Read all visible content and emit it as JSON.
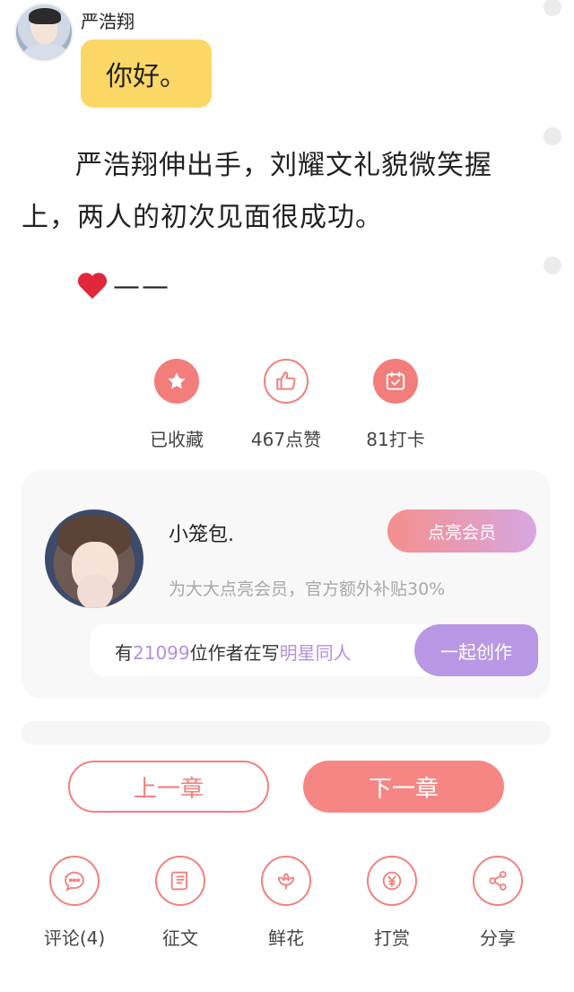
{
  "chat": {
    "speaker_name": "严浩翔",
    "message": "你好。"
  },
  "story": {
    "paragraph": "严浩翔伸出手，刘耀文礼貌微笑握上，两人的初次见面很成功。",
    "dash_line": "——"
  },
  "actions": [
    {
      "label": "已收藏",
      "icon": "star-icon"
    },
    {
      "label": "467点赞",
      "icon": "thumbs-up-icon"
    },
    {
      "label": "81打卡",
      "icon": "calendar-check-icon"
    }
  ],
  "member_card": {
    "name": "小笼包.",
    "button_label": "点亮会员",
    "description": "为大大点亮会员，官方额外补贴30%",
    "writer_prefix": "有",
    "writer_count": "21099",
    "writer_middle": "位作者在写",
    "writer_topic": "明星同人",
    "create_button": "一起创作"
  },
  "chapter_nav": {
    "prev": "上一章",
    "next": "下一章"
  },
  "bottom_bar": [
    {
      "label": "评论(4)",
      "icon": "comment-icon"
    },
    {
      "label": "征文",
      "icon": "scroll-icon"
    },
    {
      "label": "鲜花",
      "icon": "flower-icon"
    },
    {
      "label": "打赏",
      "icon": "yen-icon"
    },
    {
      "label": "分享",
      "icon": "share-icon"
    }
  ],
  "colors": {
    "accent": "#f27d7b",
    "bubble": "#fbd766",
    "purple": "#b898e4",
    "highlight": "#b58fe0"
  }
}
